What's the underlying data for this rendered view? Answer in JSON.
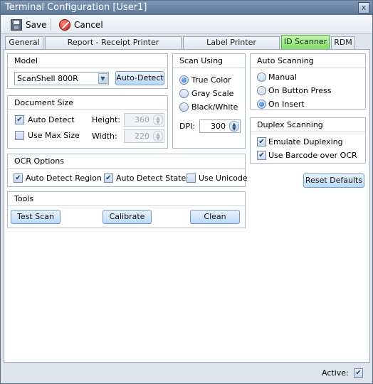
{
  "window": {
    "title": "Terminal Configuration [User1]",
    "close_glyph": "x"
  },
  "toolbar": {
    "save_label": "Save",
    "cancel_label": "Cancel",
    "save_icon": "save-icon",
    "cancel_icon": "cancel-icon"
  },
  "tabs": [
    {
      "label": "General"
    },
    {
      "label": "Report - Receipt Printer Assignments"
    },
    {
      "label": "Label Printer Assignments"
    },
    {
      "label": "ID Scanner",
      "active": true
    },
    {
      "label": "RDM"
    }
  ],
  "model": {
    "title": "Model",
    "selected": "ScanShell 800R",
    "auto_detect_label": "Auto-Detect"
  },
  "document_size": {
    "title": "Document Size",
    "auto_detect_label": "Auto Detect",
    "auto_detect_checked": true,
    "use_max_size_label": "Use Max Size",
    "use_max_size_checked": false,
    "height_label": "Height:",
    "height_value": "360",
    "width_label": "Width:",
    "width_value": "220"
  },
  "scan_using": {
    "title": "Scan Using",
    "options": [
      "True Color",
      "Gray Scale",
      "Black/White"
    ],
    "selected_index": 0,
    "dpi_label": "DPI:",
    "dpi_value": "300"
  },
  "auto_scanning": {
    "title": "Auto Scanning",
    "options": [
      "Manual",
      "On Button Press",
      "On Insert"
    ],
    "selected_index": 2
  },
  "duplex_scanning": {
    "title": "Duplex Scanning",
    "emulate_label": "Emulate Duplexing",
    "emulate_checked": true,
    "barcode_label": "Use Barcode over OCR",
    "barcode_checked": true
  },
  "reset_defaults_label": "Reset Defaults",
  "ocr_options": {
    "title": "OCR Options",
    "region_label": "Auto Detect Region",
    "region_checked": true,
    "state_label": "Auto Detect State",
    "state_checked": true,
    "unicode_label": "Use Unicode",
    "unicode_checked": false
  },
  "tools": {
    "title": "Tools",
    "test_scan_label": "Test Scan",
    "calibrate_label": "Calibrate",
    "clean_label": "Clean"
  },
  "status": {
    "active_label": "Active:",
    "active_checked": true
  },
  "glyphs": {
    "check": "✔",
    "down": "▼",
    "up": "▲"
  },
  "colors": {
    "active_tab": "#7fdc63",
    "title_bar": "#5a7596",
    "button_border": "#6c9bd2"
  }
}
